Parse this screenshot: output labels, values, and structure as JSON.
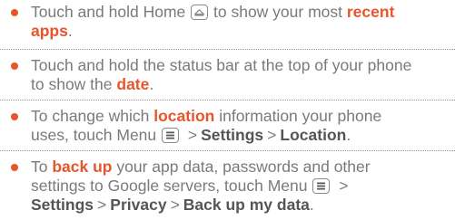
{
  "tips": [
    {
      "line1": {
        "pre": "Touch and hold Home",
        "post": "to show your most",
        "hl": "recent"
      },
      "line2": {
        "hl": "apps",
        "post": "."
      }
    },
    {
      "line1": {
        "text": "Touch and hold the status bar at the top of your phone"
      },
      "line2": {
        "pre": "to show the",
        "hl": "date",
        "post": "."
      }
    },
    {
      "line1": {
        "pre": "To change which",
        "hl": "location",
        "post": "information your phone"
      },
      "line2": {
        "pre": "uses, touch Menu",
        "gt": ">",
        "settings": "Settings",
        "gt2": ">",
        "loc": "Location",
        "end": "."
      }
    },
    {
      "line1": {
        "pre": "To",
        "hl": "back up",
        "post": "your app data, passwords and other"
      },
      "line2": {
        "pre": "settings to Google servers, touch Menu",
        "gt": ">"
      },
      "line3": {
        "settings": "Settings",
        "gt": ">",
        "privacy": "Privacy",
        "gt2": ">",
        "backup": "Back up my data",
        "end": "."
      }
    }
  ],
  "icons": {
    "home": "home-icon",
    "menu": "menu-icon"
  },
  "colors": {
    "accent": "#e8552a",
    "text": "#7a7a7a",
    "ui_text": "#555555"
  }
}
